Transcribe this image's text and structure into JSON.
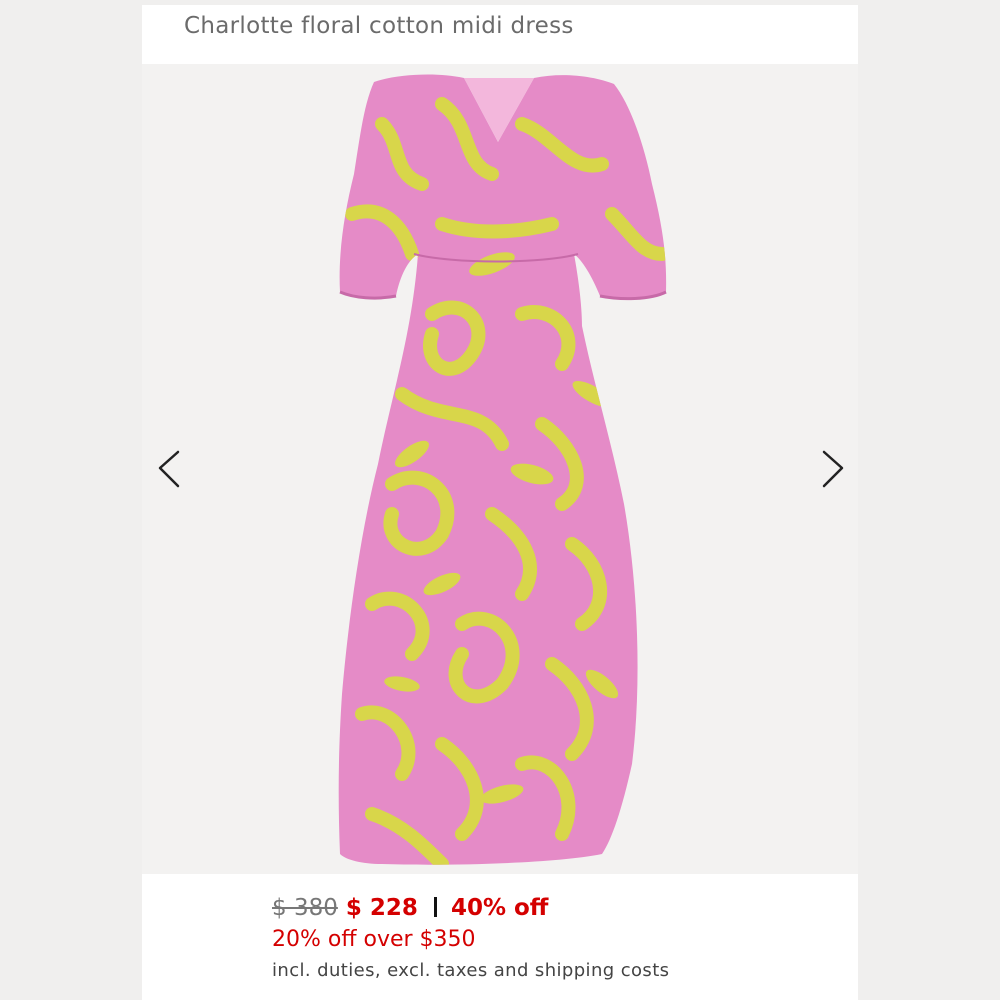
{
  "product": {
    "title": "Charlotte floral cotton midi dress",
    "image": "floral pink and yellow midi dress",
    "colors": {
      "fabric": "#e58bc7",
      "print": "#d8d64a"
    }
  },
  "gallery": {
    "prev_icon": "chevron-left-icon",
    "next_icon": "chevron-right-icon"
  },
  "pricing": {
    "original_price": "$ 380",
    "sale_price": "$ 228",
    "discount": "40% off",
    "promo": "20% off over $350",
    "note": "incl. duties, excl. taxes and shipping costs",
    "accent_color": "#d40000"
  }
}
